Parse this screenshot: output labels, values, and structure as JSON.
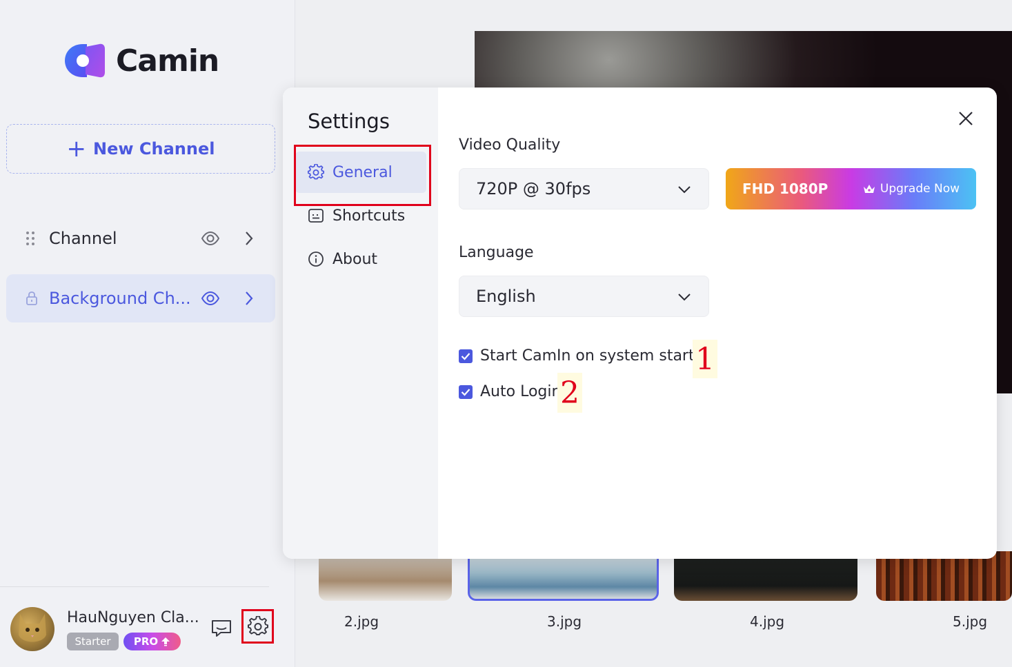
{
  "app": {
    "name": "Camin"
  },
  "sidebar": {
    "new_channel_label": "New Channel",
    "channels": [
      {
        "label": "Channel",
        "locked": false
      },
      {
        "label": "Background Ch...",
        "locked": true
      }
    ],
    "user": {
      "name": "HauNguyen Cla...",
      "plan_badge": "Starter",
      "pro_badge": "PRO"
    }
  },
  "thumbnails": [
    {
      "label": "2.jpg"
    },
    {
      "label": "3.jpg",
      "selected": true
    },
    {
      "label": "4.jpg"
    },
    {
      "label": "5.jpg"
    }
  ],
  "settings": {
    "title": "Settings",
    "nav": [
      {
        "label": "General",
        "icon": "gear-icon",
        "active": true
      },
      {
        "label": "Shortcuts",
        "icon": "keyboard-icon"
      },
      {
        "label": "About",
        "icon": "info-icon"
      }
    ],
    "video_quality": {
      "label": "Video Quality",
      "value": "720P @ 30fps",
      "upgrade_quality": "FHD 1080P",
      "upgrade_label": "Upgrade Now"
    },
    "language": {
      "label": "Language",
      "value": "English"
    },
    "options": [
      {
        "label": "Start CamIn on system startup",
        "checked": true,
        "marker": "1"
      },
      {
        "label": "Auto Login",
        "checked": true,
        "marker": "2"
      }
    ]
  },
  "colors": {
    "accent": "#4b58de",
    "highlight_box": "#e0001b",
    "selected_row": "#e1e6f6"
  }
}
